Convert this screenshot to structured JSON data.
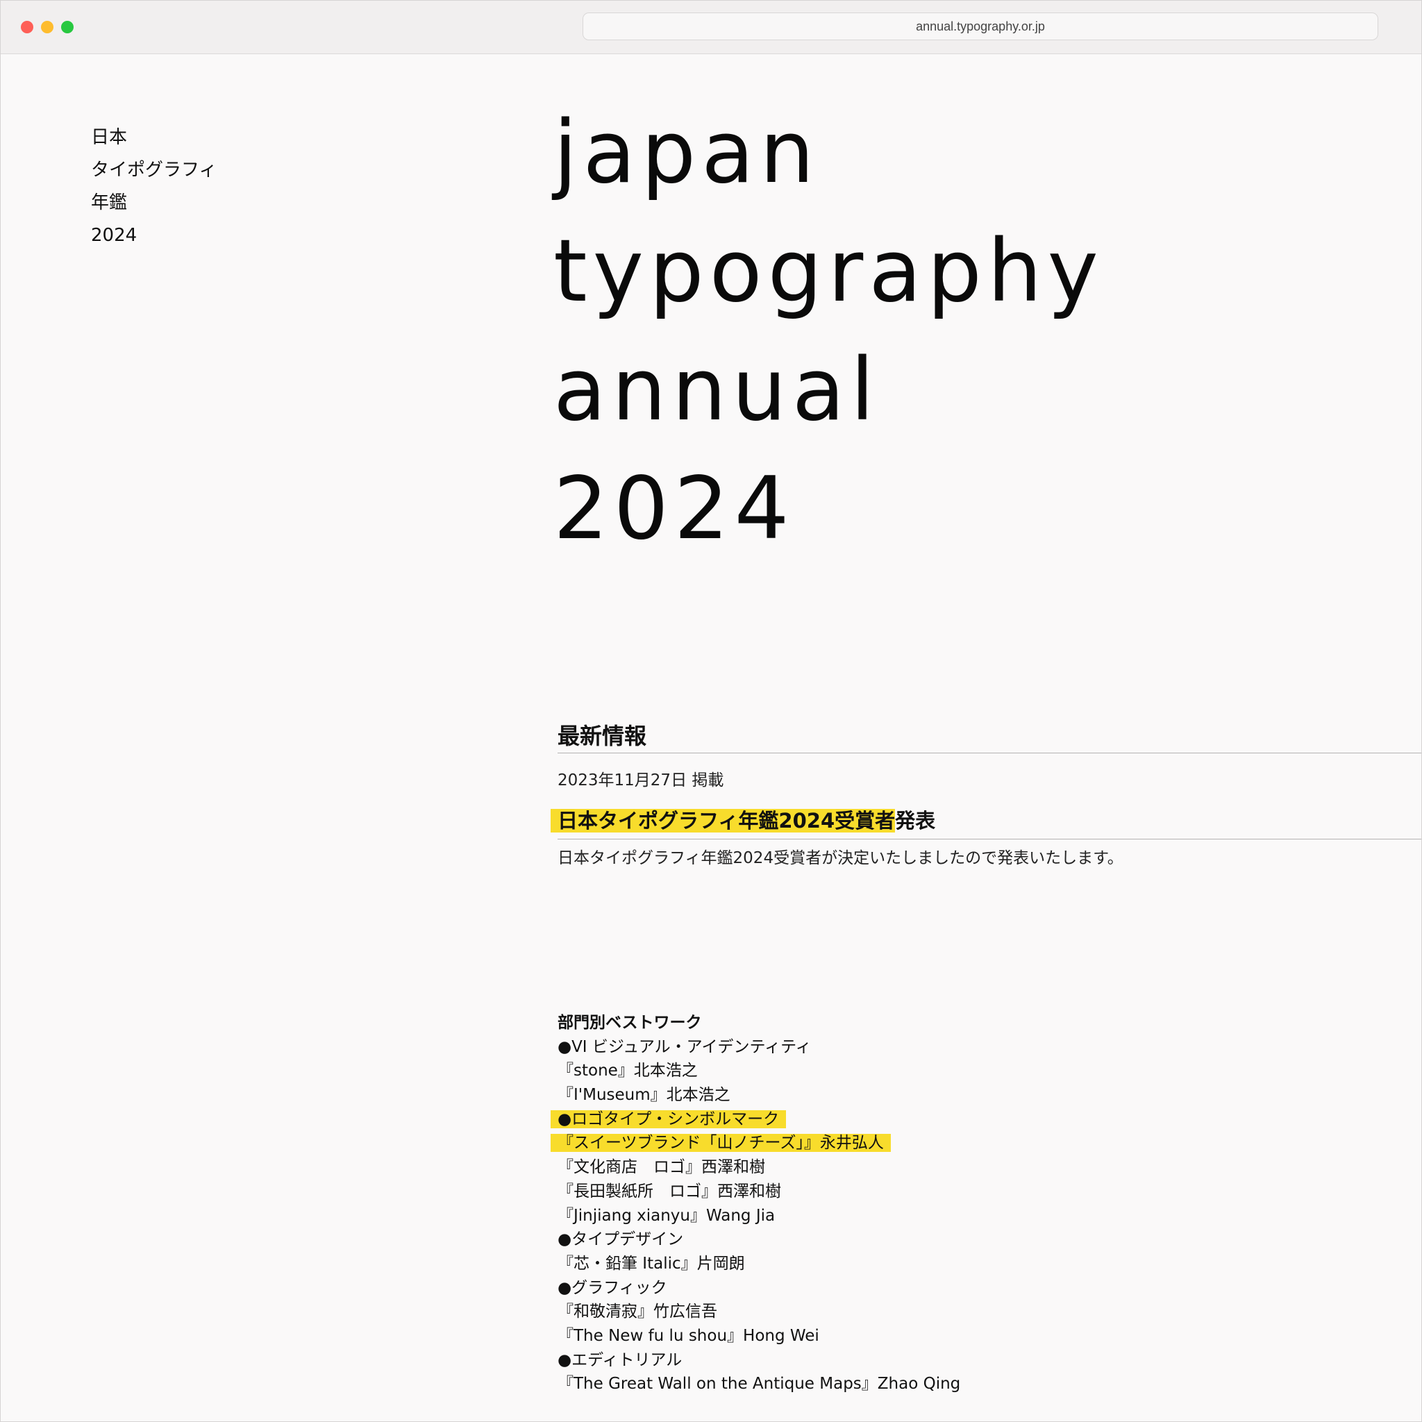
{
  "browser": {
    "url": "annual.typography.or.jp"
  },
  "sidebar": {
    "title_lines": [
      "日本",
      "タイポグラフィ",
      "年鑑",
      "2024"
    ]
  },
  "hero": {
    "lines": [
      "japan",
      "typography",
      "annual",
      "2024"
    ]
  },
  "news": {
    "heading": "最新情報",
    "date": "2023年11月27日 掲載",
    "title_highlight": "日本タイポグラフィ年鑑2024受賞者",
    "title_rest": "発表",
    "summary": "日本タイポグラフィ年鑑2024受賞者が決定いたしましたので発表いたします。"
  },
  "awards": {
    "heading": "部門別ベストワーク",
    "lines": [
      {
        "text": "●VI ビジュアル・アイデンティティ",
        "highlight": false
      },
      {
        "text": "『stone』北本浩之",
        "highlight": false
      },
      {
        "text": "『I'Museum』北本浩之",
        "highlight": false
      },
      {
        "text": "●ロゴタイプ・シンボルマーク",
        "highlight": true
      },
      {
        "text": "『スイーツブランド「山ノチーズ」』永井弘人",
        "highlight": true
      },
      {
        "text": "『文化商店　ロゴ』西澤和樹",
        "highlight": false
      },
      {
        "text": "『長田製紙所　ロゴ』西澤和樹",
        "highlight": false
      },
      {
        "text": "『Jinjiang xianyu』Wang Jia",
        "highlight": false
      },
      {
        "text": "●タイプデザイン",
        "highlight": false
      },
      {
        "text": "『芯・鉛筆 Italic』片岡朗",
        "highlight": false
      },
      {
        "text": "●グラフィック",
        "highlight": false
      },
      {
        "text": "『和敬清寂』竹広信吾",
        "highlight": false
      },
      {
        "text": "『The New fu lu shou』Hong Wei",
        "highlight": false
      },
      {
        "text": "●エディトリアル",
        "highlight": false
      },
      {
        "text": "『The Great Wall on the Antique Maps』Zhao Qing",
        "highlight": false
      }
    ]
  },
  "colors": {
    "highlight": "#f8dc2c",
    "close": "#fe5f57",
    "minimize": "#febc2e",
    "maximize": "#28c840"
  }
}
